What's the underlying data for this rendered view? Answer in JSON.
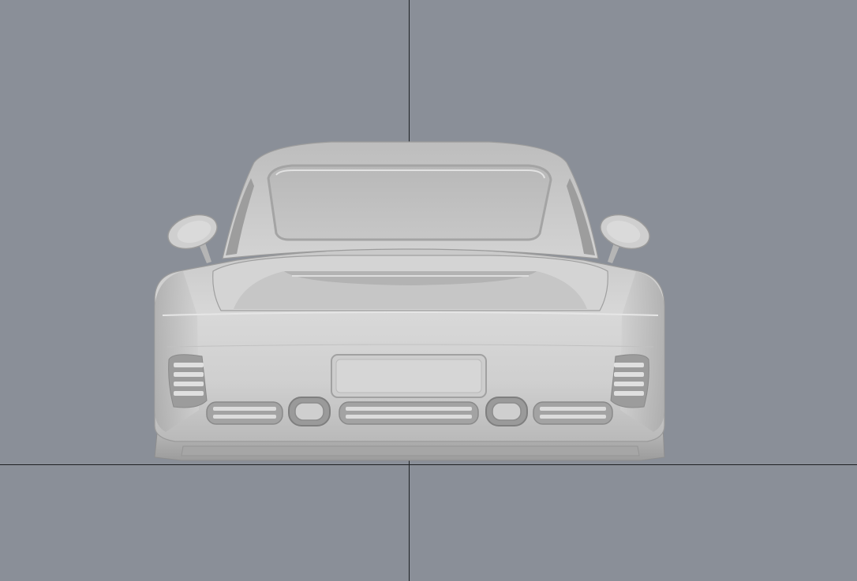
{
  "viewport": {
    "view": "back",
    "background_color": "#8a8f98",
    "grid_axis_color": "#1e2124",
    "model_color": "#d6d6d6"
  },
  "model": {
    "icon": "car-rear-3d-model"
  }
}
